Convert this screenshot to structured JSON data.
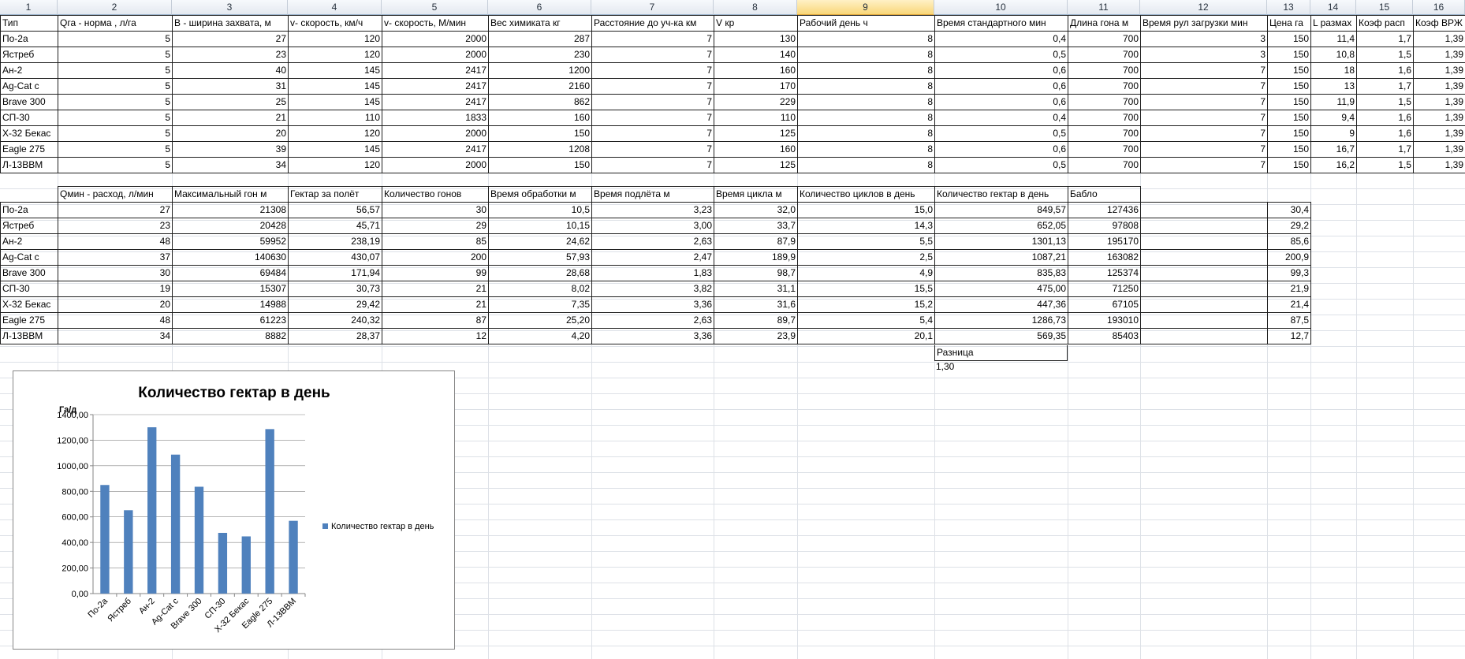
{
  "column_headers": [
    "1",
    "2",
    "3",
    "4",
    "5",
    "6",
    "7",
    "8",
    "9",
    "10",
    "11",
    "12",
    "13",
    "14",
    "15",
    "16"
  ],
  "selected_column": "9",
  "table1": {
    "headers": [
      "Тип",
      "Qга -  норма , л/га",
      "В - ширина захвата, м",
      "v- скорость, км/ч",
      "v- скорость, М/мин",
      "Вес химиката кг",
      "Расстояние до уч-ка км",
      "V кр",
      "Рабочий день ч",
      "Время стандартного мин",
      "Длина гона м",
      "Время рул загрузки мин",
      "Цена га",
      "L размах",
      "Коэф расп",
      "Коэф ВРЖ"
    ],
    "rows": [
      [
        "По-2а",
        "5",
        "27",
        "120",
        "2000",
        "287",
        "7",
        "130",
        "8",
        "0,4",
        "700",
        "3",
        "150",
        "11,4",
        "1,7",
        "1,39"
      ],
      [
        "Ястреб",
        "5",
        "23",
        "120",
        "2000",
        "230",
        "7",
        "140",
        "8",
        "0,5",
        "700",
        "3",
        "150",
        "10,8",
        "1,5",
        "1,39"
      ],
      [
        "Ан-2",
        "5",
        "40",
        "145",
        "2417",
        "1200",
        "7",
        "160",
        "8",
        "0,6",
        "700",
        "7",
        "150",
        "18",
        "1,6",
        "1,39"
      ],
      [
        "Ag-Cat c",
        "5",
        "31",
        "145",
        "2417",
        "2160",
        "7",
        "170",
        "8",
        "0,6",
        "700",
        "7",
        "150",
        "13",
        "1,7",
        "1,39"
      ],
      [
        "Brave 300",
        "5",
        "25",
        "145",
        "2417",
        "862",
        "7",
        "229",
        "8",
        "0,6",
        "700",
        "7",
        "150",
        "11,9",
        "1,5",
        "1,39"
      ],
      [
        "СП-30",
        "5",
        "21",
        "110",
        "1833",
        "160",
        "7",
        "110",
        "8",
        "0,4",
        "700",
        "7",
        "150",
        "9,4",
        "1,6",
        "1,39"
      ],
      [
        "Х-32 Бекас",
        "5",
        "20",
        "120",
        "2000",
        "150",
        "7",
        "125",
        "8",
        "0,5",
        "700",
        "7",
        "150",
        "9",
        "1,6",
        "1,39"
      ],
      [
        "Eagle 275",
        "5",
        "39",
        "145",
        "2417",
        "1208",
        "7",
        "160",
        "8",
        "0,6",
        "700",
        "7",
        "150",
        "16,7",
        "1,7",
        "1,39"
      ],
      [
        "Л-13ВВМ",
        "5",
        "34",
        "120",
        "2000",
        "150",
        "7",
        "125",
        "8",
        "0,5",
        "700",
        "7",
        "150",
        "16,2",
        "1,5",
        "1,39"
      ]
    ]
  },
  "table2": {
    "headers": [
      "",
      "Qмин - расход, л/мин",
      "Максимальный гон м",
      "Гектар за полёт",
      "Количество  гонов",
      "Время обработки м",
      "Время подлёта м",
      "Время цикла м",
      "Количество циклов в день",
      "Количество гектар в день",
      "Бабло",
      "",
      ""
    ],
    "rows": [
      [
        "По-2а",
        "27",
        "21308",
        "56,57",
        "30",
        "10,5",
        "3,23",
        "32,0",
        "15,0",
        "849,57",
        "127436",
        "",
        "30,4"
      ],
      [
        "Ястреб",
        "23",
        "20428",
        "45,71",
        "29",
        "10,15",
        "3,00",
        "33,7",
        "14,3",
        "652,05",
        "97808",
        "",
        "29,2"
      ],
      [
        "Ан-2",
        "48",
        "59952",
        "238,19",
        "85",
        "24,62",
        "2,63",
        "87,9",
        "5,5",
        "1301,13",
        "195170",
        "",
        "85,6"
      ],
      [
        "Ag-Cat c",
        "37",
        "140630",
        "430,07",
        "200",
        "57,93",
        "2,47",
        "189,9",
        "2,5",
        "1087,21",
        "163082",
        "",
        "200,9"
      ],
      [
        "Brave 300",
        "30",
        "69484",
        "171,94",
        "99",
        "28,68",
        "1,83",
        "98,7",
        "4,9",
        "835,83",
        "125374",
        "",
        "99,3"
      ],
      [
        "СП-30",
        "19",
        "15307",
        "30,73",
        "21",
        "8,02",
        "3,82",
        "31,1",
        "15,5",
        "475,00",
        "71250",
        "",
        "21,9"
      ],
      [
        "Х-32 Бекас",
        "20",
        "14988",
        "29,42",
        "21",
        "7,35",
        "3,36",
        "31,6",
        "15,2",
        "447,36",
        "67105",
        "",
        "21,4"
      ],
      [
        "Eagle 275",
        "48",
        "61223",
        "240,32",
        "87",
        "25,20",
        "2,63",
        "89,7",
        "5,4",
        "1286,73",
        "193010",
        "",
        "87,5"
      ],
      [
        "Л-13ВВМ",
        "34",
        "8882",
        "28,37",
        "12",
        "4,20",
        "3,36",
        "23,9",
        "20,1",
        "569,35",
        "85403",
        "",
        "12,7"
      ]
    ]
  },
  "diff": {
    "label": "Разница",
    "value": "1,30"
  },
  "chart_data": {
    "type": "bar",
    "title": "Количество гектар в день",
    "ylabel": "Га/д",
    "xlabel": "",
    "categories": [
      "По-2а",
      "Ястреб",
      "Ан-2",
      "Ag-Cat c",
      "Brave 300",
      "СП-30",
      "Х-32 Бекас",
      "Eagle 275",
      "Л-13ВВМ"
    ],
    "series": [
      {
        "name": "Количество гектар в день",
        "values": [
          849.57,
          652.05,
          1301.13,
          1087.21,
          835.83,
          475.0,
          447.36,
          1286.73,
          569.35
        ]
      }
    ],
    "ylim": [
      0,
      1400
    ],
    "yticks": [
      "0,00",
      "200,00",
      "400,00",
      "600,00",
      "800,00",
      "1000,00",
      "1200,00",
      "1400,00"
    ],
    "legend_position": "right",
    "grid": true,
    "bar_color": "#4f81bd"
  }
}
